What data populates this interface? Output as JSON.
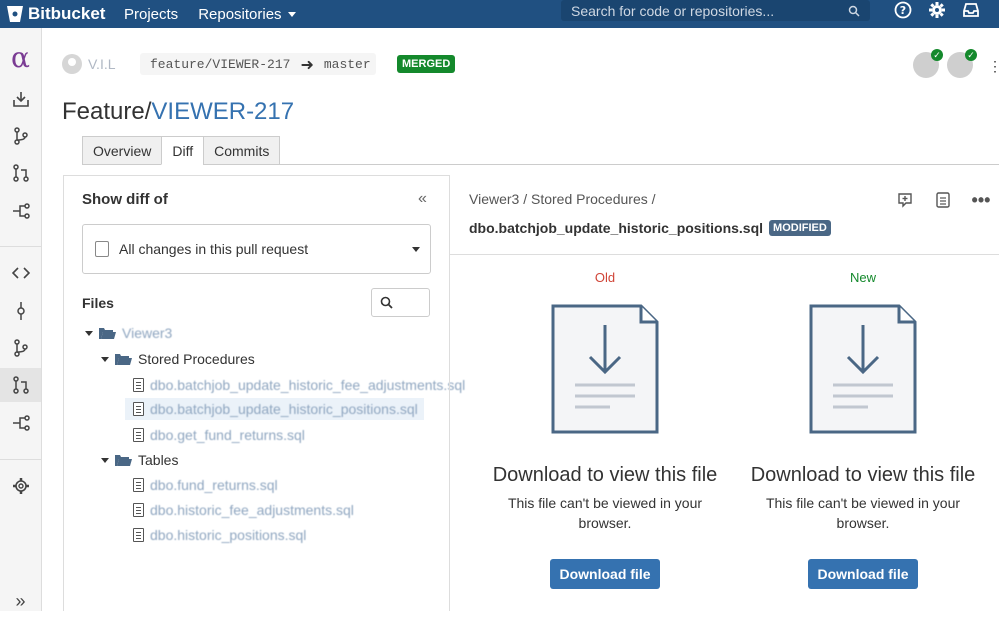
{
  "topbar": {
    "brand": "Bitbucket",
    "nav": [
      "Projects",
      "Repositories"
    ],
    "search_placeholder": "Search for code or repositories..."
  },
  "header": {
    "author": "V.I.L",
    "source_branch": "feature/VIEWER-217",
    "target_branch": "master",
    "status": "MERGED",
    "title_prefix": "Feature/",
    "title_link": "VIEWER-217"
  },
  "tabs": [
    "Overview",
    "Diff",
    "Commits"
  ],
  "active_tab": "Diff",
  "sidebar": {
    "heading": "Show diff of",
    "collapse": "«",
    "select_value": "All changes in this pull request",
    "files_label": "Files",
    "tree": {
      "root": "Viewer3",
      "folders": [
        {
          "name": "Stored Procedures",
          "files": [
            "dbo.batchjob_update_historic_fee_adjustments.sql",
            "dbo.batchjob_update_historic_positions.sql",
            "dbo.get_fund_returns.sql"
          ]
        },
        {
          "name": "Tables",
          "files": [
            "dbo.fund_returns.sql",
            "dbo.historic_fee_adjustments.sql",
            "dbo.historic_positions.sql"
          ]
        }
      ]
    }
  },
  "diff": {
    "breadcrumb": "Viewer3 / Stored Procedures /",
    "filename": "dbo.batchjob_update_historic_positions.sql",
    "badge": "MODIFIED",
    "old_label": "Old",
    "new_label": "New",
    "download_title": "Download to view this file",
    "download_sub": "This file can't be viewed in your browser.",
    "download_button": "Download file"
  },
  "colors": {
    "topbar": "#205081",
    "link": "#3572b0",
    "merged": "#14892c",
    "old": "#d04437",
    "new": "#14892c"
  }
}
